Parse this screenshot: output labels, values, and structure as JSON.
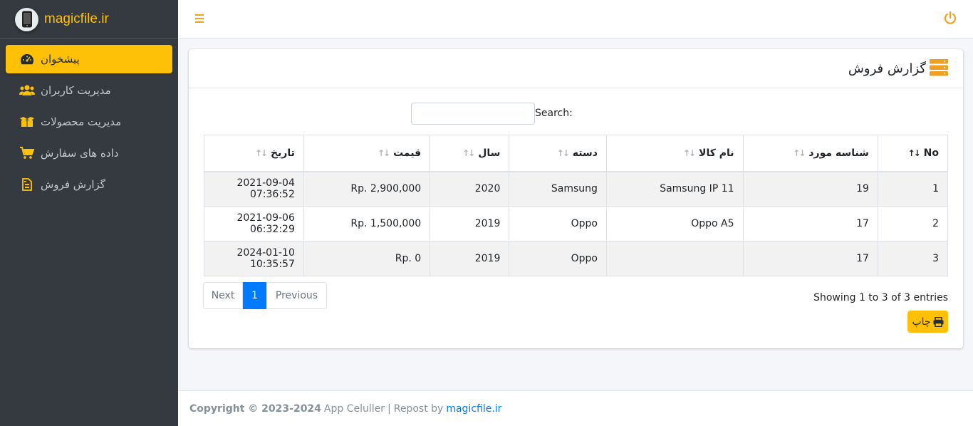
{
  "brand": {
    "name": "magicfile.ir"
  },
  "sidebar": {
    "items": [
      {
        "label": "پیشخوان",
        "icon": "tachometer-icon",
        "active": true
      },
      {
        "label": "مدیریت کاربران",
        "icon": "users-icon",
        "active": false
      },
      {
        "label": "مدیریت محصولات",
        "icon": "box-open-icon",
        "active": false
      },
      {
        "label": "داده های سفارش",
        "icon": "shopping-cart-icon",
        "active": false
      },
      {
        "label": "گزارش فروش",
        "icon": "file-invoice-icon",
        "active": false
      }
    ]
  },
  "topbar": {
    "menu_icon": "bars-icon",
    "power_icon": "power-off-icon"
  },
  "card": {
    "title": "گزارش فروش",
    "title_icon": "server-icon",
    "search_label": "Search:",
    "search_value": ""
  },
  "table": {
    "headers": [
      "No",
      "شناسه مورد",
      "نام کالا",
      "دسته",
      "سال",
      "قیمت",
      "تاریخ"
    ],
    "rows": [
      [
        "1",
        "19",
        "Samsung IP 11",
        "Samsung",
        "2020",
        "Rp. 2,900,000",
        "2021-09-04 07:36:52"
      ],
      [
        "2",
        "17",
        "Oppo A5",
        "Oppo",
        "2019",
        "Rp. 1,500,000",
        "2021-09-06 06:32:29"
      ],
      [
        "3",
        "17",
        "",
        "Oppo",
        "2019",
        "Rp. 0",
        "2024-01-10 10:35:57"
      ]
    ]
  },
  "pagination": {
    "next": "Next",
    "current": "1",
    "previous": "Previous"
  },
  "info": "Showing 1 to 3 of 3 entries",
  "print_label": "چاپ",
  "footer": {
    "copyright": "Copyright © 2023-2024",
    "app": "App Celuller",
    "separator": "|",
    "repost": "Repost by",
    "link": "magicfile.ir"
  },
  "colors": {
    "accent": "#ffc107",
    "sidebar_bg": "#343a40",
    "link": "#007bff"
  }
}
